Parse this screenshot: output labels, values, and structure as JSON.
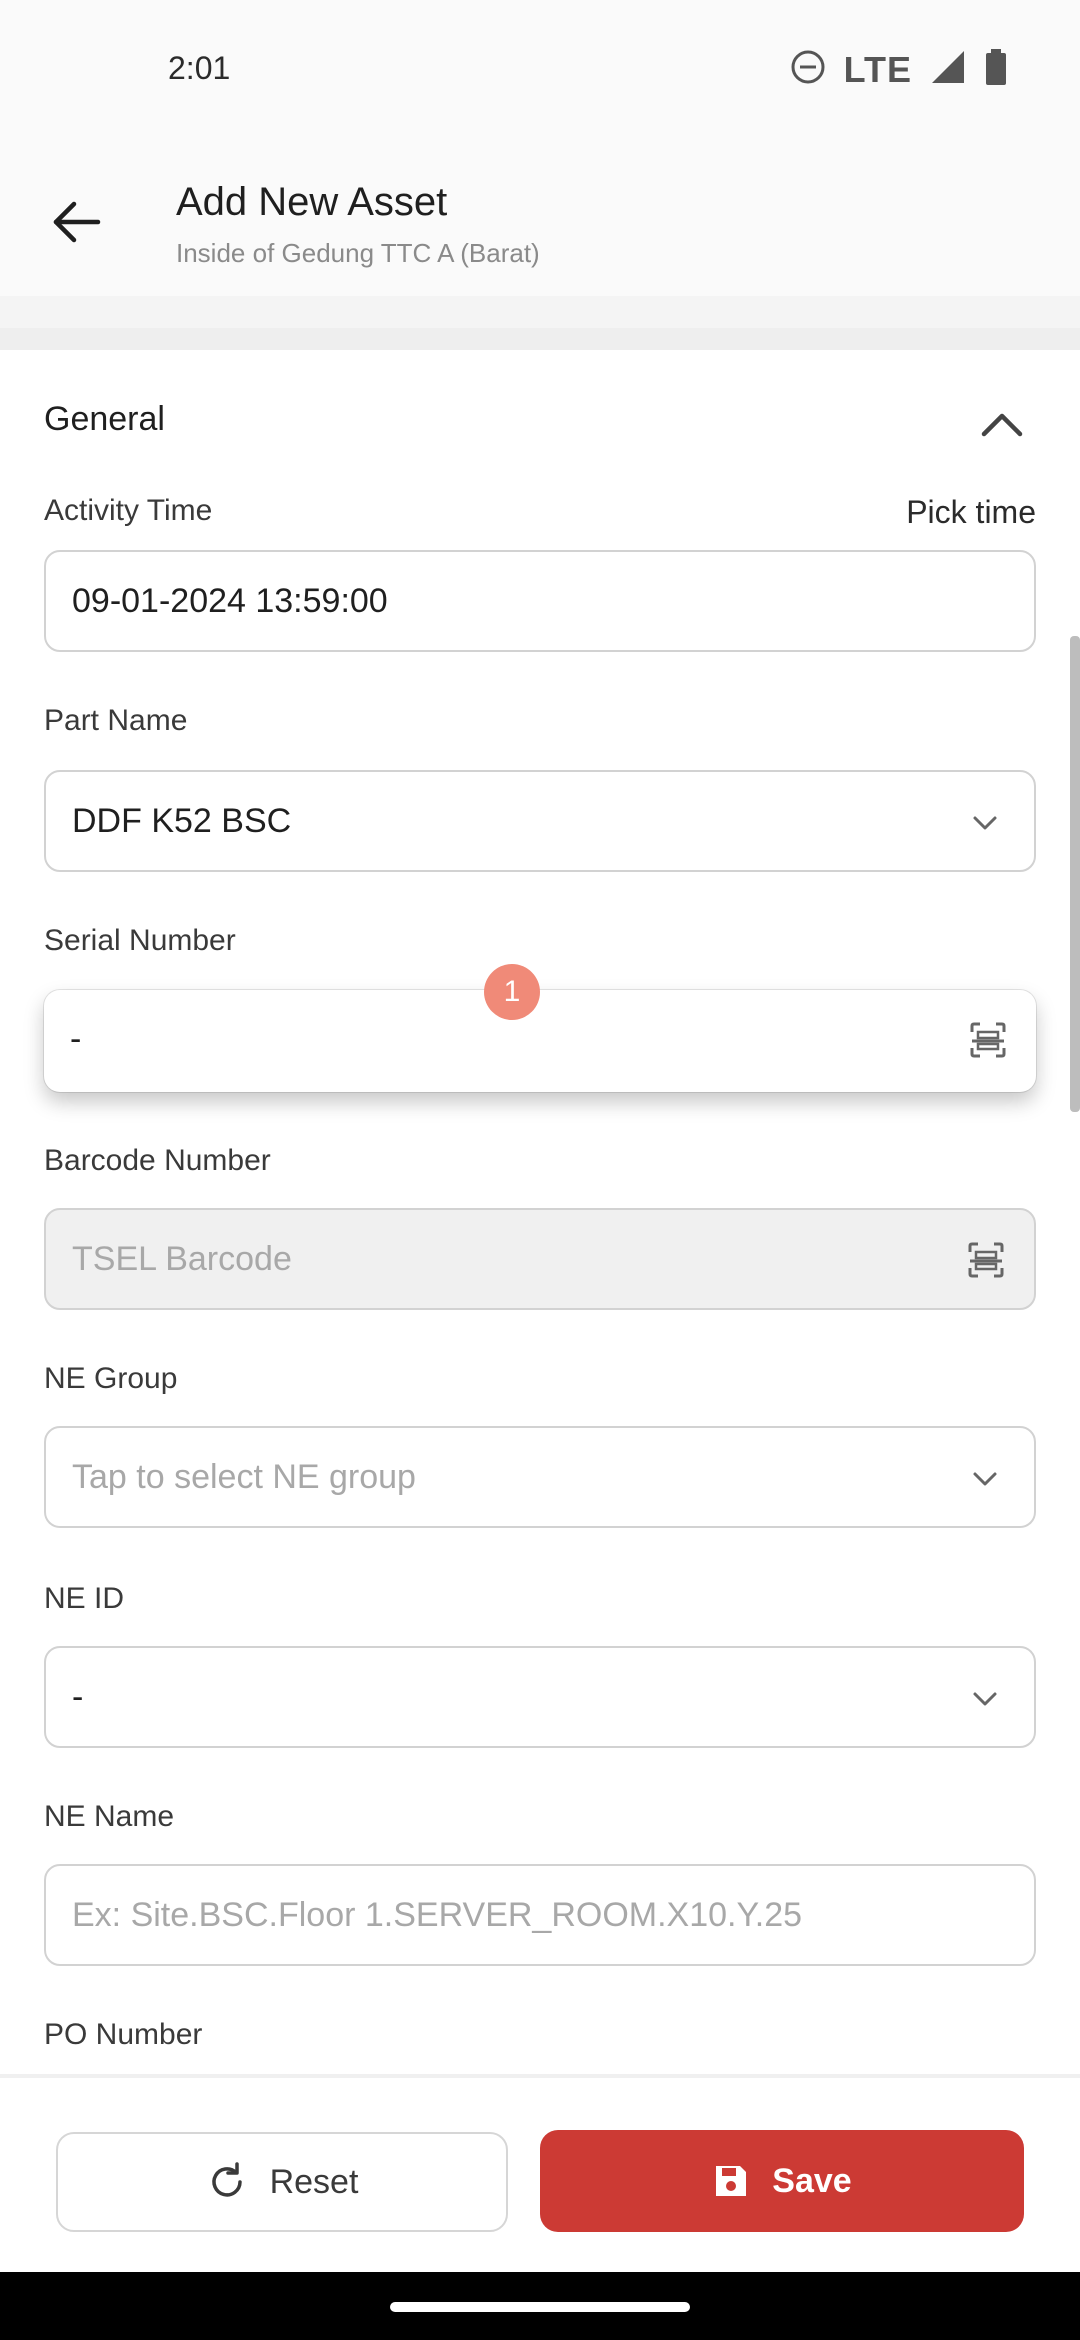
{
  "status_bar": {
    "time": "2:01",
    "network": "LTE",
    "icons": [
      "do-not-disturb-icon",
      "signal-icon",
      "battery-icon"
    ]
  },
  "app_bar": {
    "title": "Add New Asset",
    "subtitle": "Inside of Gedung TTC A (Barat)"
  },
  "section": {
    "title": "General",
    "expanded": true
  },
  "fields": {
    "activity_time": {
      "label": "Activity Time",
      "action": "Pick time",
      "value": "09-01-2024 13:59:00"
    },
    "part_name": {
      "label": "Part Name",
      "value": "DDF K52 BSC"
    },
    "serial_number": {
      "label": "Serial Number",
      "value": "-",
      "badge": "1"
    },
    "barcode_number": {
      "label": "Barcode Number",
      "placeholder": "TSEL Barcode"
    },
    "ne_group": {
      "label": "NE Group",
      "placeholder": "Tap to select NE group"
    },
    "ne_id": {
      "label": "NE ID",
      "value": "-"
    },
    "ne_name": {
      "label": "NE Name",
      "placeholder": "Ex: Site.BSC.Floor 1.SERVER_ROOM.X10.Y.25"
    },
    "po_number": {
      "label": "PO Number"
    }
  },
  "buttons": {
    "reset": "Reset",
    "save": "Save"
  },
  "colors": {
    "accent": "#cc3a34",
    "badge": "#f08a78"
  }
}
